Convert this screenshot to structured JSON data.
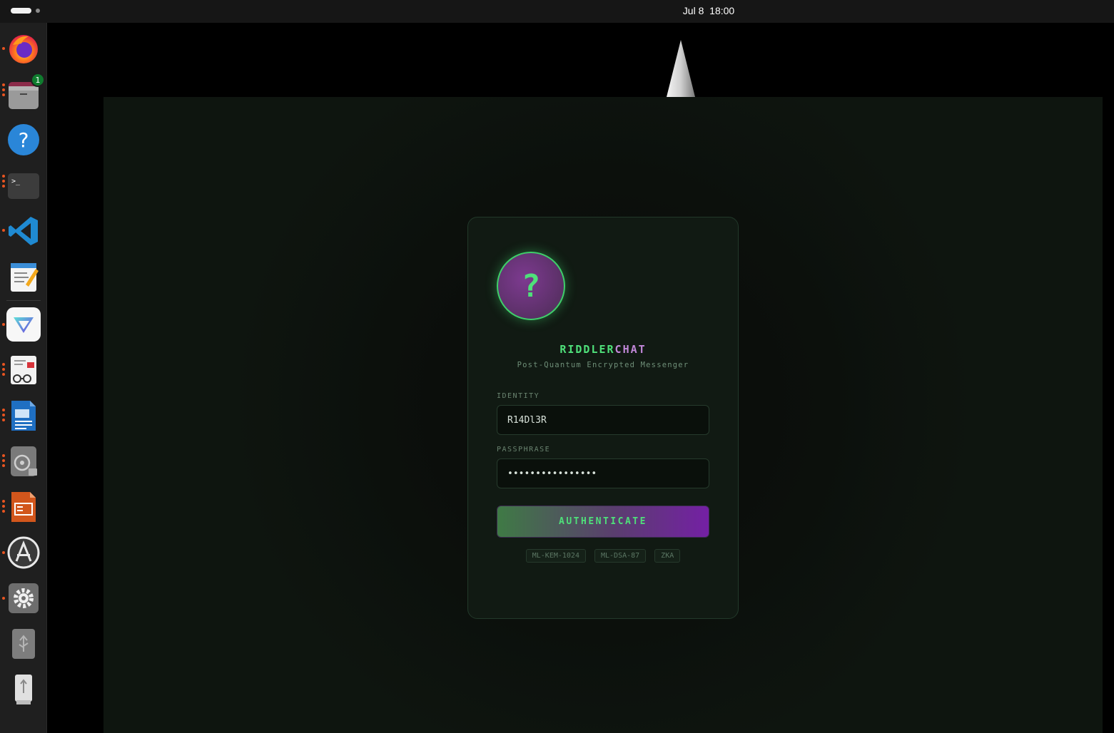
{
  "topbar": {
    "clock_date": "Jul 8",
    "clock_time": "18:00"
  },
  "dock": {
    "items": [
      {
        "name": "firefox-icon",
        "running": 1
      },
      {
        "name": "files-icon",
        "running": 3,
        "badge": "1"
      },
      {
        "name": "help-icon",
        "running": 0
      },
      {
        "name": "terminal-icon",
        "running": 3
      },
      {
        "name": "vscode-icon",
        "running": 1
      },
      {
        "name": "text-editor-icon",
        "running": 0
      },
      {
        "name": "proton-vpn-icon",
        "running": 1
      },
      {
        "name": "document-viewer-icon",
        "running": 3
      },
      {
        "name": "libreoffice-writer-icon",
        "running": 3
      },
      {
        "name": "disk-utility-icon",
        "running": 3
      },
      {
        "name": "libreoffice-impress-icon",
        "running": 3
      },
      {
        "name": "software-updater-icon",
        "running": 1
      },
      {
        "name": "settings-icon",
        "running": 1
      },
      {
        "name": "usb-drive-icon",
        "running": 0
      },
      {
        "name": "usb-drive-2-icon",
        "running": 0
      }
    ]
  },
  "app": {
    "logo_glyph": "?",
    "title_part1": "RIDDLER",
    "title_part2": "CHAT",
    "subtitle": "Post-Quantum Encrypted Messenger",
    "identity_label": "IDENTITY",
    "identity_value": "R14Dl3R",
    "passphrase_label": "PASSPHRASE",
    "passphrase_value": "••••••••••••••••",
    "auth_button": "AUTHENTICATE",
    "tags": [
      "ML-KEM-1024",
      "ML-DSA-87",
      "ZKA"
    ]
  },
  "colors": {
    "accent_green": "#4fe07a",
    "accent_purple": "#c187d8",
    "dock_running_dot": "#e95420"
  }
}
